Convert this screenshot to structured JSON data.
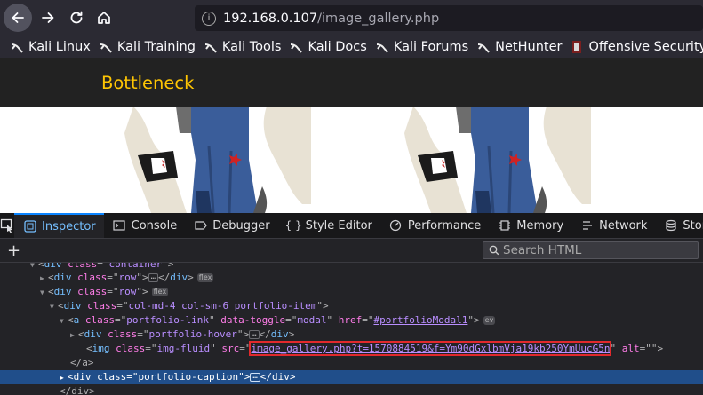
{
  "browser": {
    "url_host": "192.168.0.107",
    "url_path": "/image_gallery.php",
    "bookmarks": [
      {
        "label": "Kali Linux",
        "icon": "kali-dragon-icon"
      },
      {
        "label": "Kali Training",
        "icon": "kali-dragon-icon"
      },
      {
        "label": "Kali Tools",
        "icon": "kali-dragon-icon"
      },
      {
        "label": "Kali Docs",
        "icon": "kali-dragon-icon"
      },
      {
        "label": "Kali Forums",
        "icon": "kali-dragon-icon"
      },
      {
        "label": "NetHunter",
        "icon": "kali-dragon-icon"
      },
      {
        "label": "Offensive Security",
        "icon": "offsec-icon"
      }
    ]
  },
  "page": {
    "brand": "Bottleneck"
  },
  "devtools": {
    "tabs": [
      {
        "label": "Inspector",
        "icon": "inspector-icon",
        "active": true
      },
      {
        "label": "Console",
        "icon": "console-icon"
      },
      {
        "label": "Debugger",
        "icon": "debugger-icon"
      },
      {
        "label": "Style Editor",
        "icon": "braces-icon"
      },
      {
        "label": "Performance",
        "icon": "performance-icon"
      },
      {
        "label": "Memory",
        "icon": "memory-icon"
      },
      {
        "label": "Network",
        "icon": "network-icon"
      },
      {
        "label": "Storage",
        "icon": "storage-icon"
      }
    ],
    "search_placeholder": "Search HTML",
    "markup": {
      "l0": {
        "tag": "div",
        "attr": "class",
        "val": "container"
      },
      "l1": {
        "tag": "div",
        "attr": "class",
        "val": "row",
        "badge": "flex"
      },
      "l2": {
        "tag": "div",
        "attr": "class",
        "val": "row",
        "badge": "flex"
      },
      "l3": {
        "tag": "div",
        "attr": "class",
        "val": "col-md-4 col-sm-6 portfolio-item"
      },
      "l4": {
        "tag": "a",
        "a1": "class",
        "v1": "portfolio-link",
        "a2": "data-toggle",
        "v2": "modal",
        "a3": "href",
        "v3": "#portfolioModal1",
        "badge": "ev"
      },
      "l5": {
        "tag": "div",
        "attr": "class",
        "val": "portfolio-hover"
      },
      "l6": {
        "tag": "img",
        "a1": "class",
        "v1": "img-fluid",
        "a2": "src",
        "v2": "image_gallery.php?t=1570884519&f=Ym90dGxlbmVja19kb250YmUucG5n",
        "a3": "alt",
        "v3": ""
      },
      "l7": {
        "close": "</a>"
      },
      "l8": {
        "tag": "div",
        "attr": "class",
        "val": "portfolio-caption"
      },
      "l9": {
        "close": "</div>"
      }
    }
  }
}
